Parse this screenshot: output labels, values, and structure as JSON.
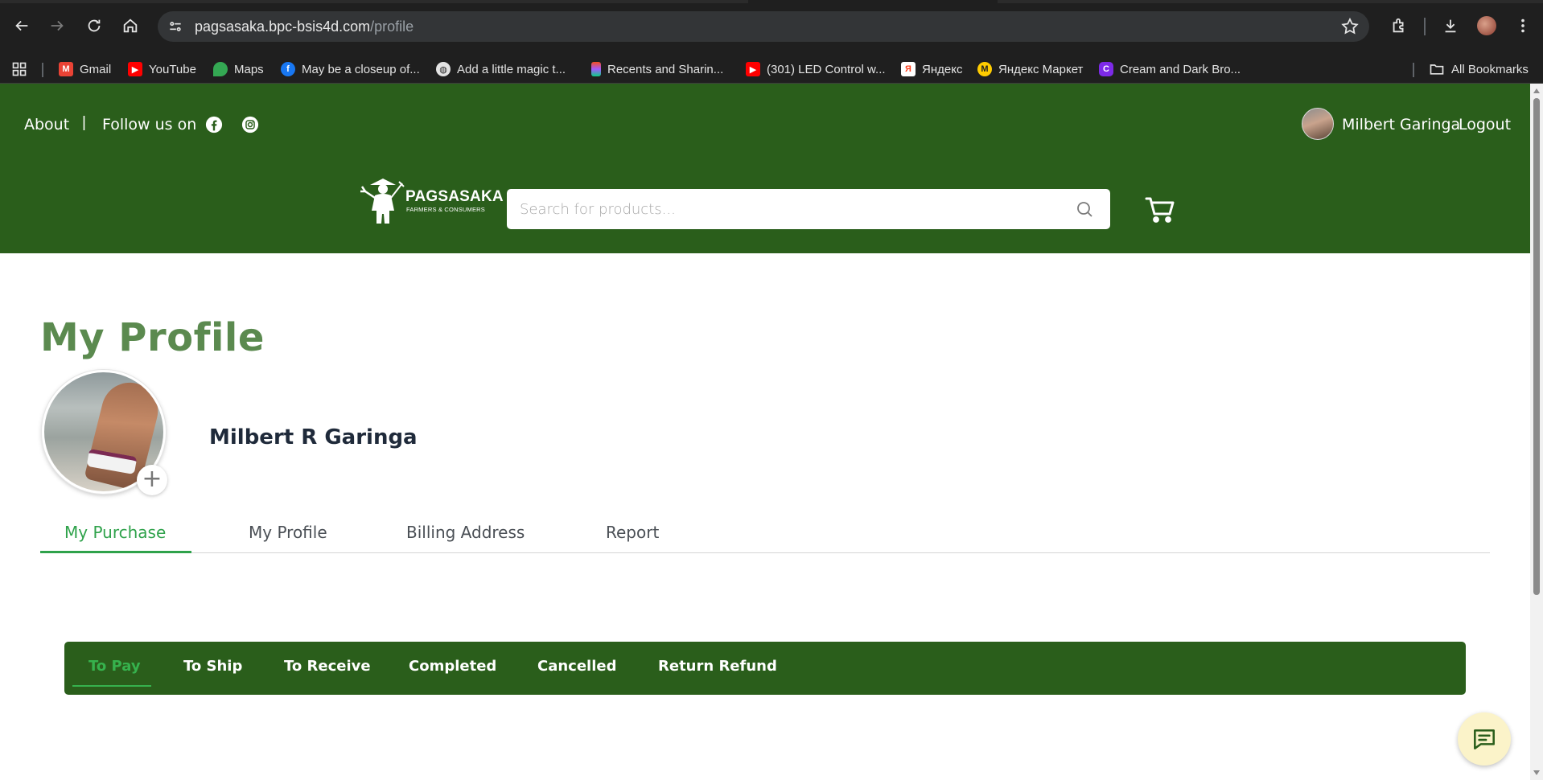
{
  "browser": {
    "url_host": "pagsasaka.bpc-bsis4d.com",
    "url_path": "/profile",
    "bookmarks": [
      {
        "label": "Gmail",
        "icon": "gmail-icon"
      },
      {
        "label": "YouTube",
        "icon": "youtube-icon"
      },
      {
        "label": "Maps",
        "icon": "maps-icon"
      },
      {
        "label": "May be a closeup of...",
        "icon": "facebook-icon"
      },
      {
        "label": "Add a little magic t...",
        "icon": "globe-icon"
      },
      {
        "label": "Recents and Sharin...",
        "icon": "figma-icon"
      },
      {
        "label": "(301) LED Control w...",
        "icon": "youtube-icon"
      },
      {
        "label": "Яндекс",
        "icon": "yandex-icon"
      },
      {
        "label": "Яндекс Маркет",
        "icon": "yandex-market-icon"
      },
      {
        "label": "Cream and Dark Bro...",
        "icon": "canva-icon"
      }
    ],
    "all_bookmarks": "All Bookmarks"
  },
  "header": {
    "about": "About",
    "pipe": "|",
    "follow": "Follow us on",
    "user_name": "Milbert Garinga",
    "logout": "Logout",
    "logo_text": "PAGSASAKA",
    "logo_sub": "FARMERS & CONSUMERS",
    "search_placeholder": "Search for products..."
  },
  "profile": {
    "title": "My Profile",
    "name": "Milbert R Garinga",
    "add_photo": "+"
  },
  "tabs": [
    {
      "label": "My Purchase",
      "active": true
    },
    {
      "label": "My Profile",
      "active": false
    },
    {
      "label": "Billing Address",
      "active": false
    },
    {
      "label": "Report",
      "active": false
    }
  ],
  "order_tabs": [
    {
      "label": "To Pay",
      "active": true
    },
    {
      "label": "To Ship",
      "active": false
    },
    {
      "label": "To Receive",
      "active": false
    },
    {
      "label": "Completed",
      "active": false
    },
    {
      "label": "Cancelled",
      "active": false
    },
    {
      "label": "Return Refund",
      "active": false
    }
  ],
  "colors": {
    "brand_green": "#2a5e1b",
    "title_green": "#5b8a4f",
    "active_tab": "#2fa24b",
    "chat_bg": "#fbf3c9"
  }
}
